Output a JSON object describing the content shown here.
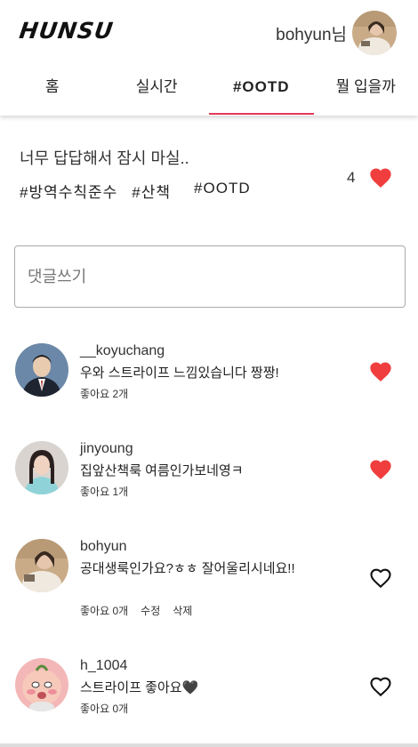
{
  "app": {
    "logo": "HUNSU",
    "user_name": "bohyun님"
  },
  "tabs": [
    {
      "label": "홈"
    },
    {
      "label": "실시간"
    },
    {
      "label": "#OOTD"
    },
    {
      "label": "뭘 입을까"
    }
  ],
  "post": {
    "title": "너무 답답해서 잠시 마실..",
    "tags": [
      "#방역수칙준수",
      "#산책",
      "#OOTD"
    ],
    "like_count": "4"
  },
  "comment_input": {
    "placeholder": "댓글쓰기"
  },
  "comments": [
    {
      "user": "__koyuchang",
      "text": "우와 스트라이프 느낌있습니다 짱짱!",
      "likes": "좋아요 2개",
      "liked": true
    },
    {
      "user": "jinyoung",
      "text": "집앞산책룩 여름인가보네영ㅋ",
      "likes": "좋아요 1개",
      "liked": true
    },
    {
      "user": "bohyun",
      "text": "공대생룩인가요?ㅎㅎ 잘어울리시네요!!",
      "likes": "좋아요 0개",
      "edit": "수정",
      "delete": "삭제",
      "liked": false
    },
    {
      "user": "h_1004",
      "text": "스트라이프 좋아요🖤",
      "likes": "좋아요 0개",
      "liked": false
    }
  ],
  "colors": {
    "accent": "#e5395a",
    "heart": "#f03e3e"
  }
}
